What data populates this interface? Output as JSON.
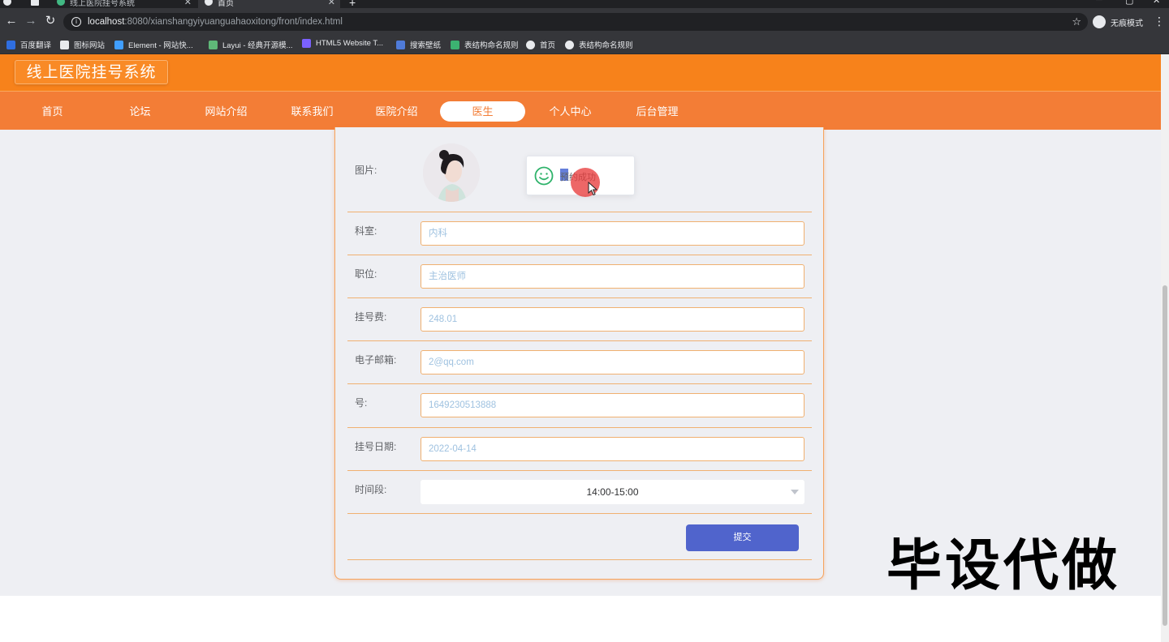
{
  "browser": {
    "tabs": [
      {
        "title": "线上医院挂号系统",
        "active": false
      },
      {
        "title": "首页",
        "active": true
      }
    ],
    "url_host": "localhost",
    "url_rest": ":8080/xianshangyiyuanguahaoxitong/front/index.html",
    "profile_label": "无痕模式",
    "bookmarks": [
      {
        "label": "百度翻译",
        "color": "#2f6ee0"
      },
      {
        "label": "图标网站",
        "color": "#e8eaed"
      },
      {
        "label": "Element - 网站快...",
        "color": "#409eff"
      },
      {
        "label": "Layui - 经典开源模...",
        "color": "#5fb878"
      },
      {
        "label": "HTML5 Website T...",
        "color": "#7b61ff"
      },
      {
        "label": "搜索壁纸",
        "color": "#4f7bd9"
      },
      {
        "label": "表结构命名规则",
        "color": "#3cb371"
      },
      {
        "label": "首页",
        "color": "#e8eaed"
      },
      {
        "label": "表结构命名规则",
        "color": "#e8eaed"
      }
    ]
  },
  "site": {
    "logo": "线上医院挂号系统",
    "nav": [
      "首页",
      "论坛",
      "网站介绍",
      "联系我们",
      "医院介绍",
      "医生",
      "个人中心",
      "后台管理"
    ],
    "active_nav": "医生",
    "colors": {
      "header": "#f7821b",
      "navbar": "#f37d36",
      "button": "#5064cc"
    }
  },
  "form": {
    "photo_label": "图片:",
    "toast_message": "预约成功",
    "fields": [
      {
        "label": "科室:",
        "value": "内科"
      },
      {
        "label": "职位:",
        "value": "主治医师"
      },
      {
        "label": "挂号费:",
        "value": "248.01"
      },
      {
        "label": "电子邮箱:",
        "value": "2@qq.com"
      },
      {
        "label": "号:",
        "value": "1649230513888"
      },
      {
        "label": "挂号日期:",
        "value": "2022-04-14"
      }
    ],
    "time_label": "时间段:",
    "time_value": "14:00-15:00",
    "submit_label": "提交"
  },
  "watermark": "毕设代做"
}
